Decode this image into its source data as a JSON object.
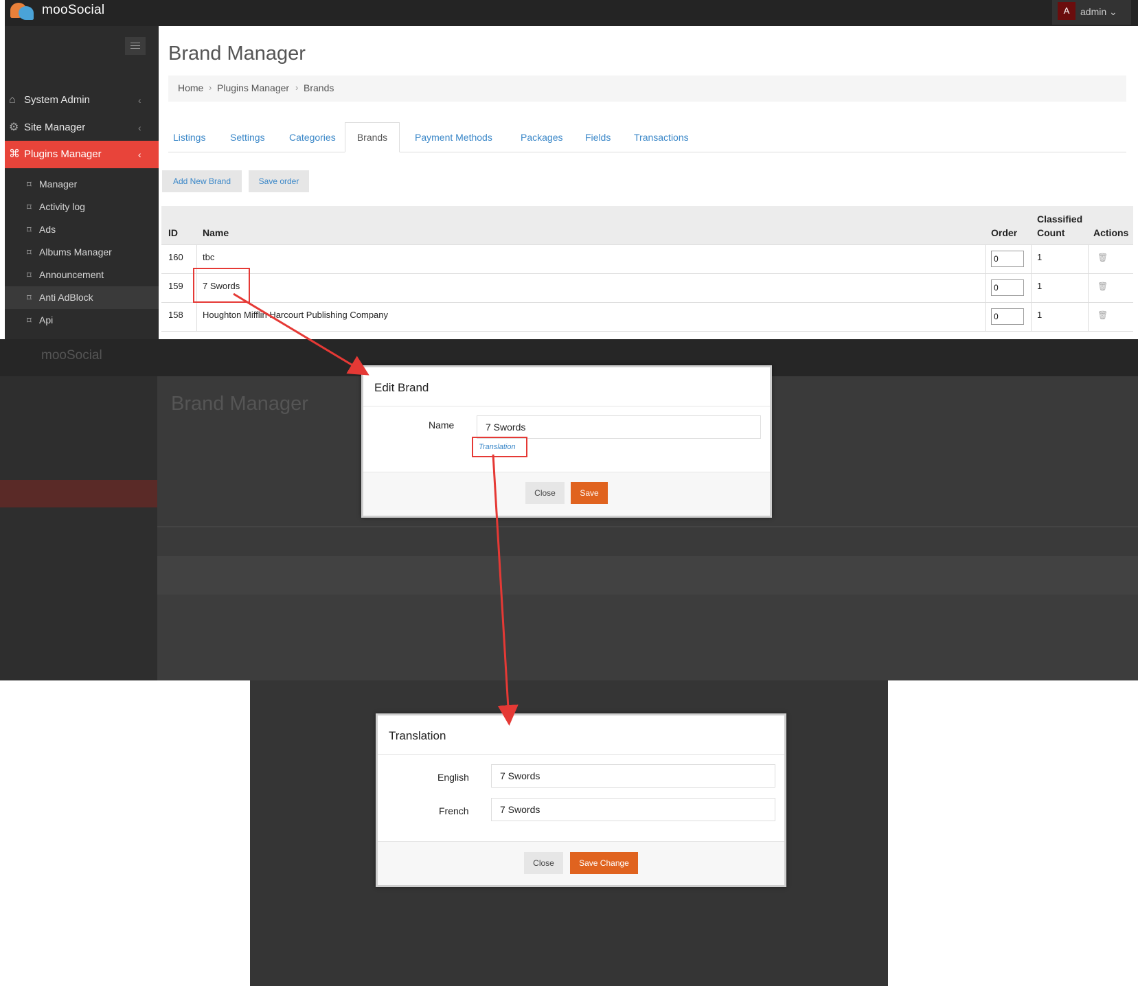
{
  "app": {
    "name": "mooSocial",
    "user_initial": "A",
    "user_name": "admin"
  },
  "sidebar": {
    "items": [
      {
        "label": "System Admin",
        "icon": "home-icon"
      },
      {
        "label": "Site Manager",
        "icon": "gears-icon"
      },
      {
        "label": "Plugins Manager",
        "icon": "tag-icon"
      }
    ],
    "sub_items": [
      "Manager",
      "Activity log",
      "Ads",
      "Albums Manager",
      "Announcement",
      "Anti AdBlock",
      "Api"
    ]
  },
  "page": {
    "title": "Brand Manager"
  },
  "breadcrumb": [
    "Home",
    "Plugins Manager",
    "Brands"
  ],
  "tabs": [
    "Listings",
    "Settings",
    "Categories",
    "Brands",
    "Payment Methods",
    "Packages",
    "Fields",
    "Transactions"
  ],
  "toolbar": {
    "add_label": "Add New Brand",
    "save_order_label": "Save order"
  },
  "table": {
    "headers": {
      "id": "ID",
      "name": "Name",
      "order": "Order",
      "classified_1": "Classified",
      "classified_2": "Count",
      "actions": "Actions"
    },
    "rows": [
      {
        "id": "160",
        "name": "tbc",
        "order": "0",
        "count": "1"
      },
      {
        "id": "159",
        "name": "7 Swords",
        "order": "0",
        "count": "1"
      },
      {
        "id": "158",
        "name": "Houghton Mifflin Harcourt Publishing Company",
        "order": "0",
        "count": "1"
      }
    ]
  },
  "edit_modal": {
    "title": "Edit Brand",
    "name_label": "Name",
    "name_value": "7 Swords",
    "translation_link": "Translation",
    "close_label": "Close",
    "save_label": "Save"
  },
  "translation_modal": {
    "title": "Translation",
    "fields": [
      {
        "label": "English",
        "value": "7 Swords"
      },
      {
        "label": "French",
        "value": "7 Swords"
      }
    ],
    "close_label": "Close",
    "save_label": "Save Change"
  },
  "colors": {
    "accent_red": "#e8443a",
    "save_orange": "#e0631f",
    "link_blue": "#3a87c8",
    "topbar": "#242424",
    "sidebar": "#2c2c2c"
  }
}
